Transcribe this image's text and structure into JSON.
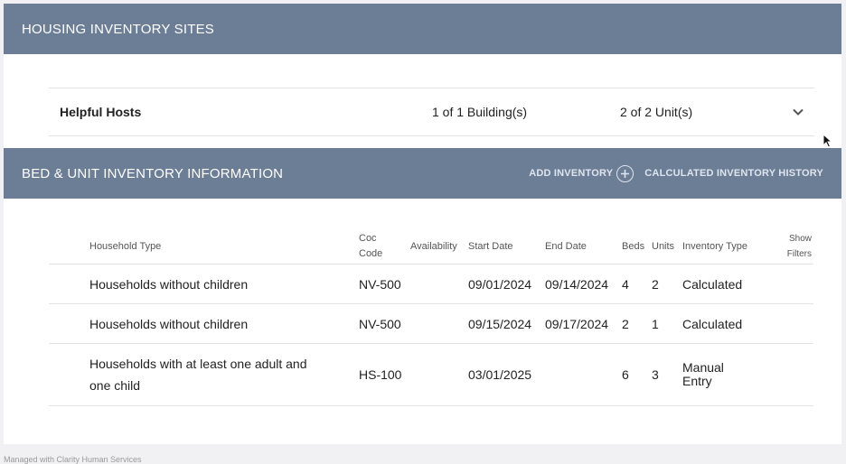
{
  "housing_sites": {
    "title": "HOUSING INVENTORY SITES",
    "site": {
      "name": "Helpful Hosts",
      "buildings": "1 of 1 Building(s)",
      "units": "2 of 2 Unit(s)"
    }
  },
  "bed_unit": {
    "title": "BED & UNIT INVENTORY INFORMATION",
    "add_inventory": "ADD INVENTORY",
    "history": "CALCULATED INVENTORY HISTORY",
    "columns": {
      "household_type": "Household Type",
      "coc_code": "Coc Code",
      "availability": "Availability",
      "start_date": "Start Date",
      "end_date": "End Date",
      "beds": "Beds",
      "units": "Units",
      "inventory_type": "Inventory Type",
      "show_filters": "Show Filters"
    },
    "rows": [
      {
        "household_type": "Households without children",
        "coc_code": "NV-500",
        "availability": "",
        "start_date": "09/01/2024",
        "end_date": "09/14/2024",
        "beds": "4",
        "units": "2",
        "inventory_type": "Calculated"
      },
      {
        "household_type": "Households without children",
        "coc_code": "NV-500",
        "availability": "",
        "start_date": "09/15/2024",
        "end_date": "09/17/2024",
        "beds": "2",
        "units": "1",
        "inventory_type": "Calculated"
      },
      {
        "household_type": "Households with at least one adult and one child",
        "coc_code": "HS-100",
        "availability": "",
        "start_date": "03/01/2025",
        "end_date": "",
        "beds": "6",
        "units": "3",
        "inventory_type": "Manual Entry"
      }
    ]
  },
  "footer": {
    "text": "Managed with Clarity Human Services"
  },
  "icons": {
    "expand": "chevron-down-icon",
    "add": "plus-circle-icon",
    "cursor": "mouse-pointer-icon"
  },
  "colors": {
    "header_bg": "#6c7d96",
    "page_bg": "#f1f1f3"
  }
}
